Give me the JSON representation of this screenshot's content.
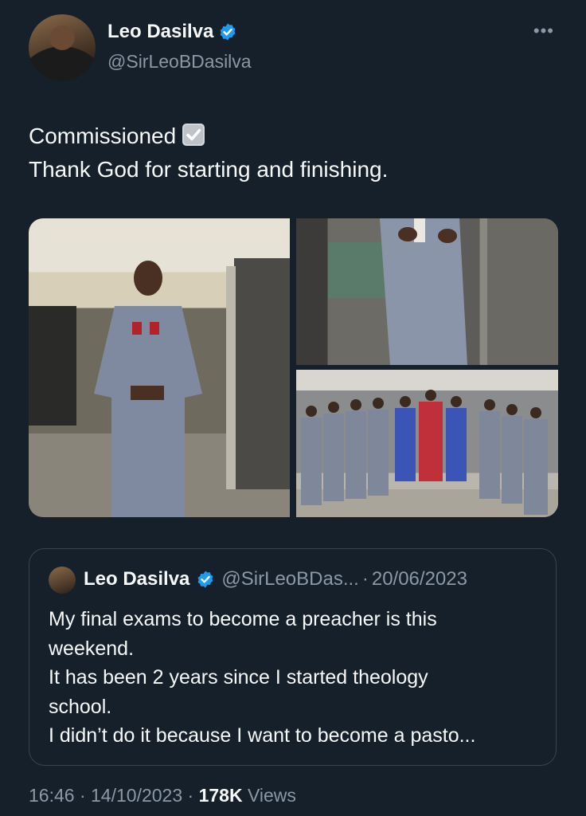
{
  "author": {
    "name": "Leo Dasilva",
    "handle": "@SirLeoBDasilva",
    "verified_color": "#1d9bf0"
  },
  "more_label": "•••",
  "tweet": {
    "line1": "Commissioned",
    "line2": "Thank God for starting and finishing."
  },
  "media": {
    "photos": [
      "graduate-in-gown-photo",
      "gown-closeup-photo",
      "group-photo"
    ]
  },
  "quoted_tweet": {
    "name": "Leo Dasilva",
    "handle": "@SirLeoBDas...",
    "separator": "·",
    "date": "20/06/2023",
    "lines": [
      "My final exams to become a preacher is this",
      "weekend.",
      "It has been 2 years since I started theology",
      "school.",
      "I didn’t do it because I want to become a pasto..."
    ]
  },
  "footer": {
    "time": "16:46",
    "dot1": "·",
    "date": "14/10/2023",
    "dot2": "·",
    "views_count": "178K",
    "views_label": "Views"
  },
  "colors": {
    "background": "#15202b",
    "text": "#f7f9f9",
    "secondary": "#8b98a5",
    "border": "#38444d",
    "accent": "#1d9bf0"
  }
}
